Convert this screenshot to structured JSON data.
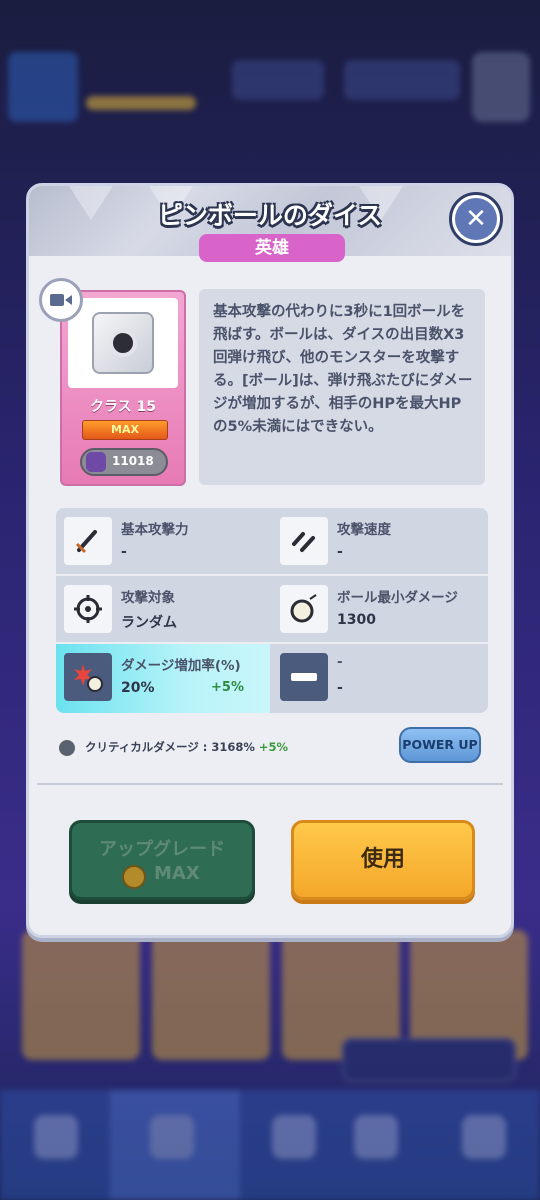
{
  "modal": {
    "title": "ピンボールのダイス",
    "rarity": "英雄",
    "dice": {
      "class_label": "クラス 15",
      "level_badge": "MAX",
      "count": "11018"
    },
    "description": "基本攻撃の代わりに3秒に1回ボールを飛ばす。ボールは、ダイスの出目数X3回弾け飛び、他のモンスターを攻撃する。[ボール]は、弾け飛ぶたびにダメージが増加するが、相手のHPを最大HPの5%未満にはできない。",
    "stats": [
      {
        "icon": "sword-icon",
        "label": "基本攻撃力",
        "value": "-"
      },
      {
        "icon": "attack-speed-icon",
        "label": "攻撃速度",
        "value": "-"
      },
      {
        "icon": "crosshair-icon",
        "label": "攻撃対象",
        "value": "ランダム"
      },
      {
        "icon": "ball-icon",
        "label": "ボール最小ダメージ",
        "value": "1300"
      },
      {
        "icon": "damage-increase-icon",
        "label": "ダメージ増加率(%)",
        "value": "20%",
        "bonus": "+5%"
      },
      {
        "icon": "dash-icon",
        "label": "-",
        "value": "-"
      }
    ],
    "crit": {
      "label": "クリティカルダメージ : 3168%",
      "bonus": "+5%"
    },
    "power_up_label": "POWER UP",
    "upgrade_label": "アップグレード",
    "upgrade_cost": "MAX",
    "use_label": "使用"
  },
  "colors": {
    "rarity": "#d964c9",
    "use_button": "#f4a72a",
    "upgrade_button": "#2e6c54",
    "highlight_stat": "#6be2ef"
  }
}
